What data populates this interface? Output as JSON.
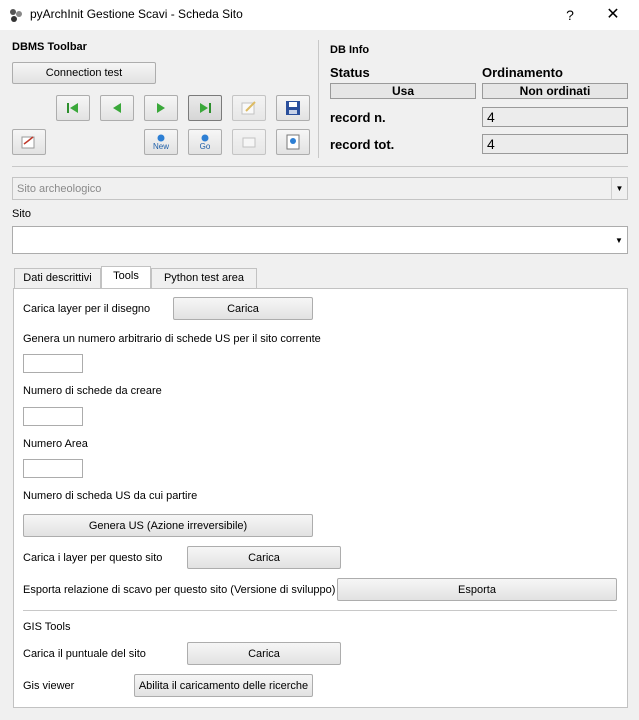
{
  "window": {
    "title": "pyArchInit Gestione Scavi - Scheda Sito",
    "help": "?",
    "close": "✕"
  },
  "dbms_toolbar": {
    "title": "DBMS Toolbar",
    "connection_test": "Connection test",
    "new_label": "New",
    "go_label": "Go"
  },
  "db_info": {
    "title": "DB Info",
    "status_label": "Status",
    "ordinamento_label": "Ordinamento",
    "status_value": "Usa",
    "ordinamento_value": "Non ordinati",
    "record_n_label": "record n.",
    "record_n_value": "4",
    "record_tot_label": "record tot.",
    "record_tot_value": "4"
  },
  "filters": {
    "sito_archeologico_placeholder": "Sito archeologico",
    "sito_label": "Sito",
    "sito_value": ""
  },
  "tabs": [
    {
      "label": "Dati descrittivi"
    },
    {
      "label": "Tools"
    },
    {
      "label": "Python test area"
    }
  ],
  "tools": {
    "carica_layer_label": "Carica layer per il disegno",
    "carica_button": "Carica",
    "genera_numero_label": "Genera un numero arbitrario di schede US per il sito corrente",
    "numero_schede_label": "Numero di schede da creare",
    "numero_area_label": "Numero Area",
    "numero_scheda_label": "Numero di scheda US da cui partire",
    "genera_us_button": "Genera US (Azione irreversibile)",
    "carica_layer_sito_label": "Carica i layer per questo sito",
    "carica_layer_sito_button": "Carica",
    "esporta_label": "Esporta relazione di scavo per questo sito (Versione di sviluppo)",
    "esporta_button": "Esporta",
    "gis_tools_label": "GIS Tools",
    "carica_puntuale_label": "Carica il puntuale del sito",
    "carica_puntuale_button": "Carica",
    "gis_viewer_label": "Gis viewer",
    "gis_viewer_button": "Abilita il caricamento delle ricerche"
  }
}
